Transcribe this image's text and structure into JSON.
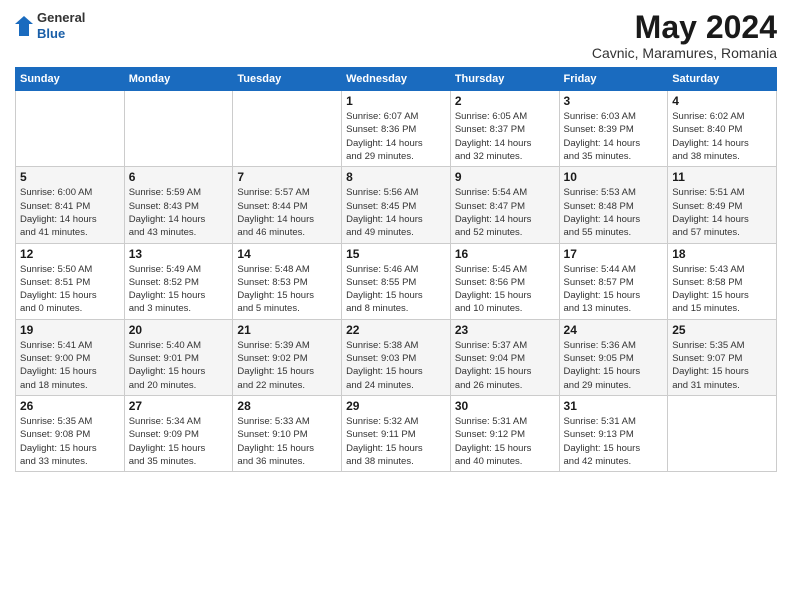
{
  "header": {
    "logo": {
      "general": "General",
      "blue": "Blue"
    },
    "title": "May 2024",
    "subtitle": "Cavnic, Maramures, Romania"
  },
  "calendar": {
    "weekdays": [
      "Sunday",
      "Monday",
      "Tuesday",
      "Wednesday",
      "Thursday",
      "Friday",
      "Saturday"
    ],
    "weeks": [
      [
        {
          "day": "",
          "info": ""
        },
        {
          "day": "",
          "info": ""
        },
        {
          "day": "",
          "info": ""
        },
        {
          "day": "1",
          "info": "Sunrise: 6:07 AM\nSunset: 8:36 PM\nDaylight: 14 hours\nand 29 minutes."
        },
        {
          "day": "2",
          "info": "Sunrise: 6:05 AM\nSunset: 8:37 PM\nDaylight: 14 hours\nand 32 minutes."
        },
        {
          "day": "3",
          "info": "Sunrise: 6:03 AM\nSunset: 8:39 PM\nDaylight: 14 hours\nand 35 minutes."
        },
        {
          "day": "4",
          "info": "Sunrise: 6:02 AM\nSunset: 8:40 PM\nDaylight: 14 hours\nand 38 minutes."
        }
      ],
      [
        {
          "day": "5",
          "info": "Sunrise: 6:00 AM\nSunset: 8:41 PM\nDaylight: 14 hours\nand 41 minutes."
        },
        {
          "day": "6",
          "info": "Sunrise: 5:59 AM\nSunset: 8:43 PM\nDaylight: 14 hours\nand 43 minutes."
        },
        {
          "day": "7",
          "info": "Sunrise: 5:57 AM\nSunset: 8:44 PM\nDaylight: 14 hours\nand 46 minutes."
        },
        {
          "day": "8",
          "info": "Sunrise: 5:56 AM\nSunset: 8:45 PM\nDaylight: 14 hours\nand 49 minutes."
        },
        {
          "day": "9",
          "info": "Sunrise: 5:54 AM\nSunset: 8:47 PM\nDaylight: 14 hours\nand 52 minutes."
        },
        {
          "day": "10",
          "info": "Sunrise: 5:53 AM\nSunset: 8:48 PM\nDaylight: 14 hours\nand 55 minutes."
        },
        {
          "day": "11",
          "info": "Sunrise: 5:51 AM\nSunset: 8:49 PM\nDaylight: 14 hours\nand 57 minutes."
        }
      ],
      [
        {
          "day": "12",
          "info": "Sunrise: 5:50 AM\nSunset: 8:51 PM\nDaylight: 15 hours\nand 0 minutes."
        },
        {
          "day": "13",
          "info": "Sunrise: 5:49 AM\nSunset: 8:52 PM\nDaylight: 15 hours\nand 3 minutes."
        },
        {
          "day": "14",
          "info": "Sunrise: 5:48 AM\nSunset: 8:53 PM\nDaylight: 15 hours\nand 5 minutes."
        },
        {
          "day": "15",
          "info": "Sunrise: 5:46 AM\nSunset: 8:55 PM\nDaylight: 15 hours\nand 8 minutes."
        },
        {
          "day": "16",
          "info": "Sunrise: 5:45 AM\nSunset: 8:56 PM\nDaylight: 15 hours\nand 10 minutes."
        },
        {
          "day": "17",
          "info": "Sunrise: 5:44 AM\nSunset: 8:57 PM\nDaylight: 15 hours\nand 13 minutes."
        },
        {
          "day": "18",
          "info": "Sunrise: 5:43 AM\nSunset: 8:58 PM\nDaylight: 15 hours\nand 15 minutes."
        }
      ],
      [
        {
          "day": "19",
          "info": "Sunrise: 5:41 AM\nSunset: 9:00 PM\nDaylight: 15 hours\nand 18 minutes."
        },
        {
          "day": "20",
          "info": "Sunrise: 5:40 AM\nSunset: 9:01 PM\nDaylight: 15 hours\nand 20 minutes."
        },
        {
          "day": "21",
          "info": "Sunrise: 5:39 AM\nSunset: 9:02 PM\nDaylight: 15 hours\nand 22 minutes."
        },
        {
          "day": "22",
          "info": "Sunrise: 5:38 AM\nSunset: 9:03 PM\nDaylight: 15 hours\nand 24 minutes."
        },
        {
          "day": "23",
          "info": "Sunrise: 5:37 AM\nSunset: 9:04 PM\nDaylight: 15 hours\nand 26 minutes."
        },
        {
          "day": "24",
          "info": "Sunrise: 5:36 AM\nSunset: 9:05 PM\nDaylight: 15 hours\nand 29 minutes."
        },
        {
          "day": "25",
          "info": "Sunrise: 5:35 AM\nSunset: 9:07 PM\nDaylight: 15 hours\nand 31 minutes."
        }
      ],
      [
        {
          "day": "26",
          "info": "Sunrise: 5:35 AM\nSunset: 9:08 PM\nDaylight: 15 hours\nand 33 minutes."
        },
        {
          "day": "27",
          "info": "Sunrise: 5:34 AM\nSunset: 9:09 PM\nDaylight: 15 hours\nand 35 minutes."
        },
        {
          "day": "28",
          "info": "Sunrise: 5:33 AM\nSunset: 9:10 PM\nDaylight: 15 hours\nand 36 minutes."
        },
        {
          "day": "29",
          "info": "Sunrise: 5:32 AM\nSunset: 9:11 PM\nDaylight: 15 hours\nand 38 minutes."
        },
        {
          "day": "30",
          "info": "Sunrise: 5:31 AM\nSunset: 9:12 PM\nDaylight: 15 hours\nand 40 minutes."
        },
        {
          "day": "31",
          "info": "Sunrise: 5:31 AM\nSunset: 9:13 PM\nDaylight: 15 hours\nand 42 minutes."
        },
        {
          "day": "",
          "info": ""
        }
      ]
    ]
  }
}
